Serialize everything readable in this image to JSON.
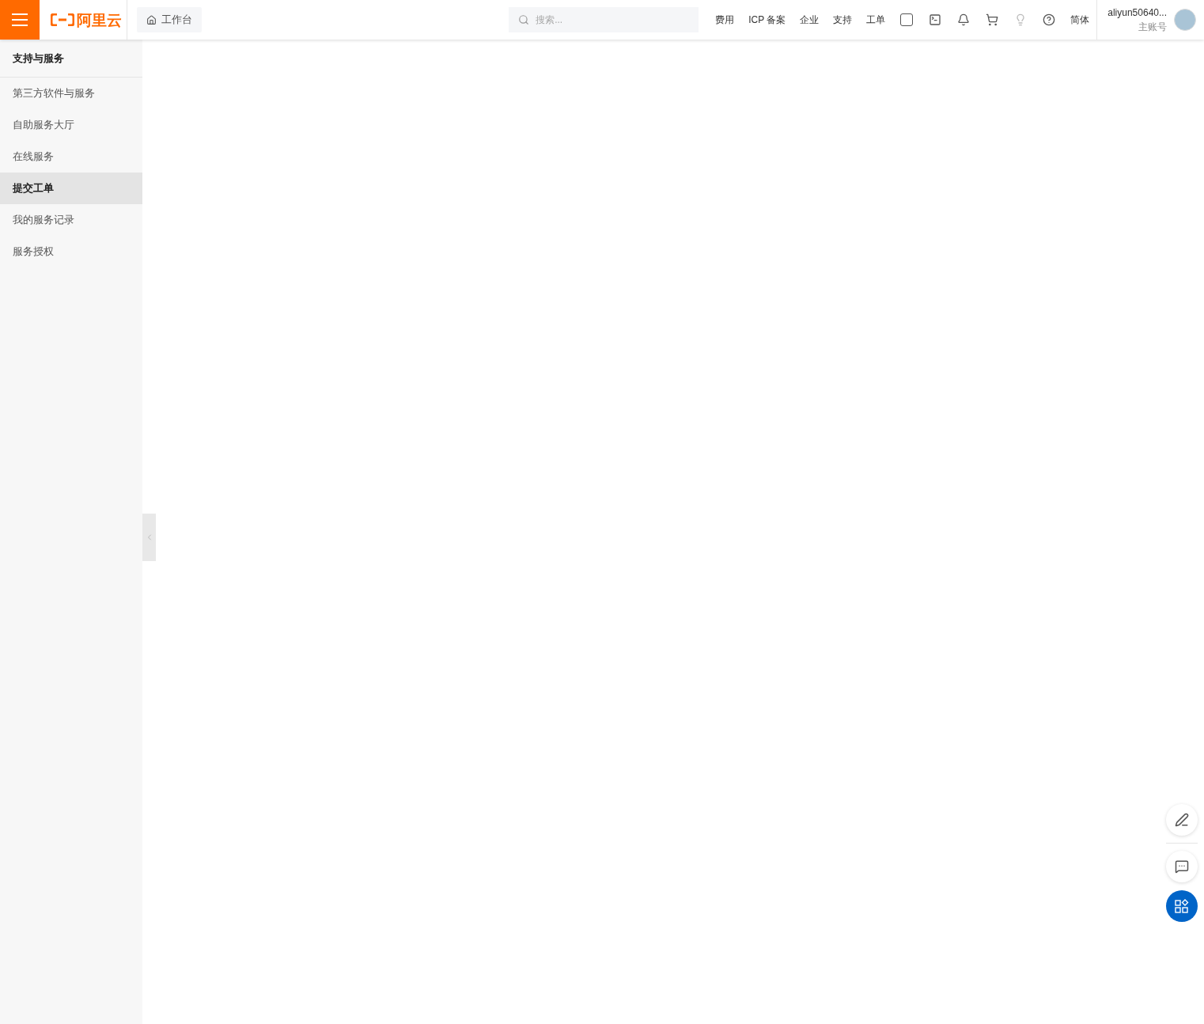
{
  "header": {
    "logo_text": "阿里云",
    "workbench": "工作台",
    "search": {
      "placeholder": "搜索..."
    },
    "nav_links": [
      "费用",
      "ICP 备案",
      "企业",
      "支持",
      "工单"
    ],
    "language": "简体",
    "user": {
      "name": "aliyun50640...",
      "role": "主账号"
    }
  },
  "sidebar": {
    "title": "支持与服务",
    "items": [
      {
        "label": "第三方软件与服务",
        "selected": false
      },
      {
        "label": "自助服务大厅",
        "selected": false
      },
      {
        "label": "在线服务",
        "selected": false
      },
      {
        "label": "提交工单",
        "selected": true
      },
      {
        "label": "我的服务记录",
        "selected": false
      },
      {
        "label": "服务授权",
        "selected": false
      }
    ]
  }
}
